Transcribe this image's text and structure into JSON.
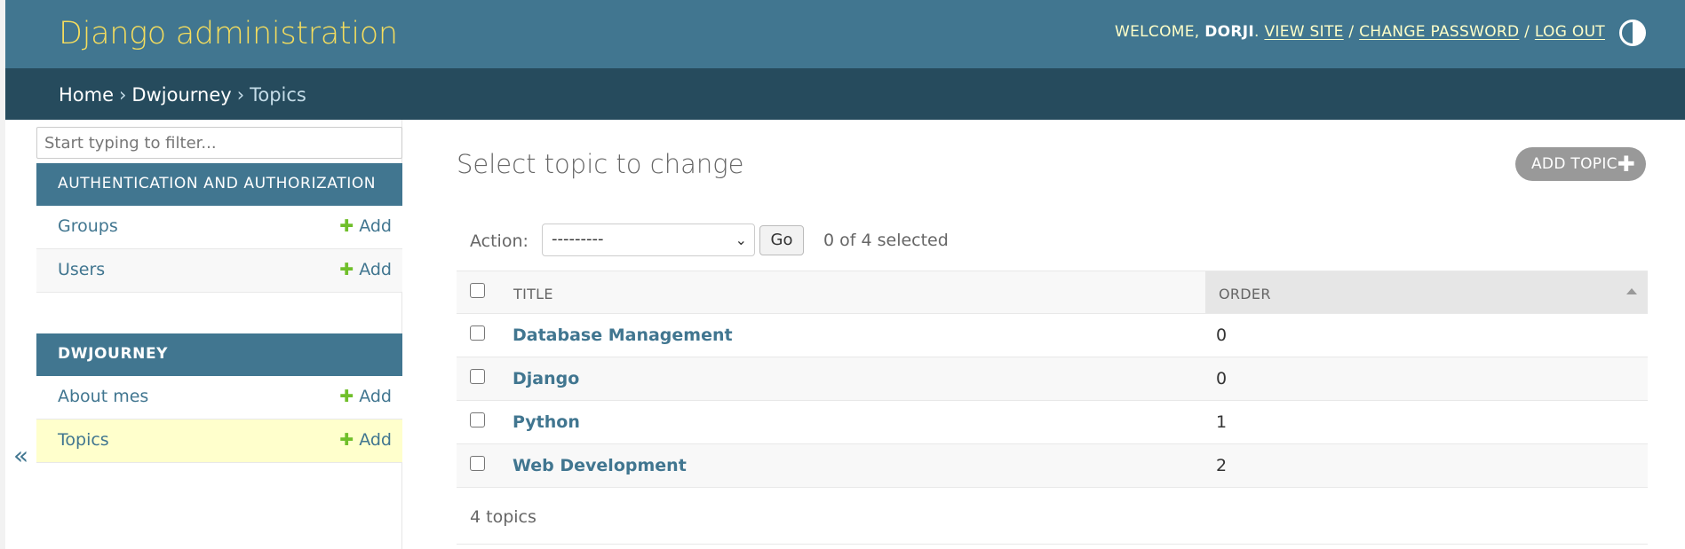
{
  "header": {
    "branding": "Django administration",
    "welcome": "WELCOME, ",
    "username": "DORJI",
    "period": ". ",
    "view_site": "VIEW SITE",
    "change_password": "CHANGE PASSWORD",
    "log_out": "LOG OUT",
    "sep": " / "
  },
  "breadcrumbs": {
    "home": "Home",
    "app": "Dwjourney",
    "current": "Topics",
    "sep": "›"
  },
  "sidebar": {
    "filter_placeholder": "Start typing to filter...",
    "modules": [
      {
        "caption": "AUTHENTICATION AND AUTHORIZATION",
        "models": [
          {
            "name": "Groups",
            "add": "Add"
          },
          {
            "name": "Users",
            "add": "Add"
          }
        ]
      },
      {
        "caption": "DWJOURNEY",
        "models": [
          {
            "name": "About mes",
            "add": "Add"
          },
          {
            "name": "Topics",
            "add": "Add"
          }
        ]
      }
    ],
    "collapse": "«"
  },
  "content": {
    "title": "Select topic to change",
    "add_button": "ADD TOPIC",
    "action_label": "Action:",
    "action_selected": "---------",
    "go": "Go",
    "selected_count": "0 of 4 selected",
    "columns": [
      "TITLE",
      "ORDER"
    ],
    "rows": [
      {
        "title": "Database Management",
        "order": "0"
      },
      {
        "title": "Django",
        "order": "0"
      },
      {
        "title": "Python",
        "order": "1"
      },
      {
        "title": "Web Development",
        "order": "2"
      }
    ],
    "paginator": "4 topics"
  },
  "colors": {
    "header": "#417690",
    "breadcrumbs": "#264b5d",
    "branding": "#f5dd5d",
    "link": "#417690",
    "add_plus": "#70bf2b",
    "current_model": "#ffffcc"
  },
  "icons": [
    "theme-toggle-icon",
    "plus-icon",
    "chevron-down-icon",
    "sort-ascending-icon",
    "collapse-sidebar-icon"
  ]
}
